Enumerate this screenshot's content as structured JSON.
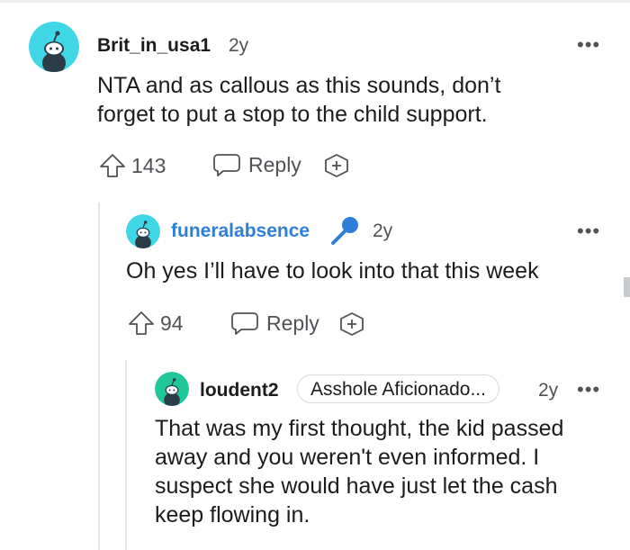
{
  "comments": [
    {
      "username": "Brit_in_usa1",
      "time": "2y",
      "text_lines": [
        "NTA and as callous as this sounds, don’t",
        "forget to put a stop to the child support."
      ],
      "upvotes": "143",
      "reply_label": "Reply",
      "avatar_color": "#3fd6e6"
    },
    {
      "username": "funeralabsence",
      "time": "2y",
      "text_lines": [
        "Oh yes I’ll have to look into that this week"
      ],
      "upvotes": "94",
      "reply_label": "Reply",
      "avatar_color": "#3fd6e6",
      "name_color": "#2f7fd8",
      "badge_icon": "microphone-icon"
    },
    {
      "username": "loudent2",
      "flair": "Asshole Aficionado...",
      "time": "2y",
      "text_lines": [
        "That was my first thought, the kid passed",
        "away and you weren't even informed. I",
        "suspect she would have just let the cash",
        "keep flowing in."
      ],
      "avatar_color": "#20c79a"
    }
  ],
  "icons": {
    "menu": "more-options-icon",
    "upvote": "upvote-arrow-icon",
    "reply": "speech-bubble-icon",
    "award": "add-award-icon"
  }
}
